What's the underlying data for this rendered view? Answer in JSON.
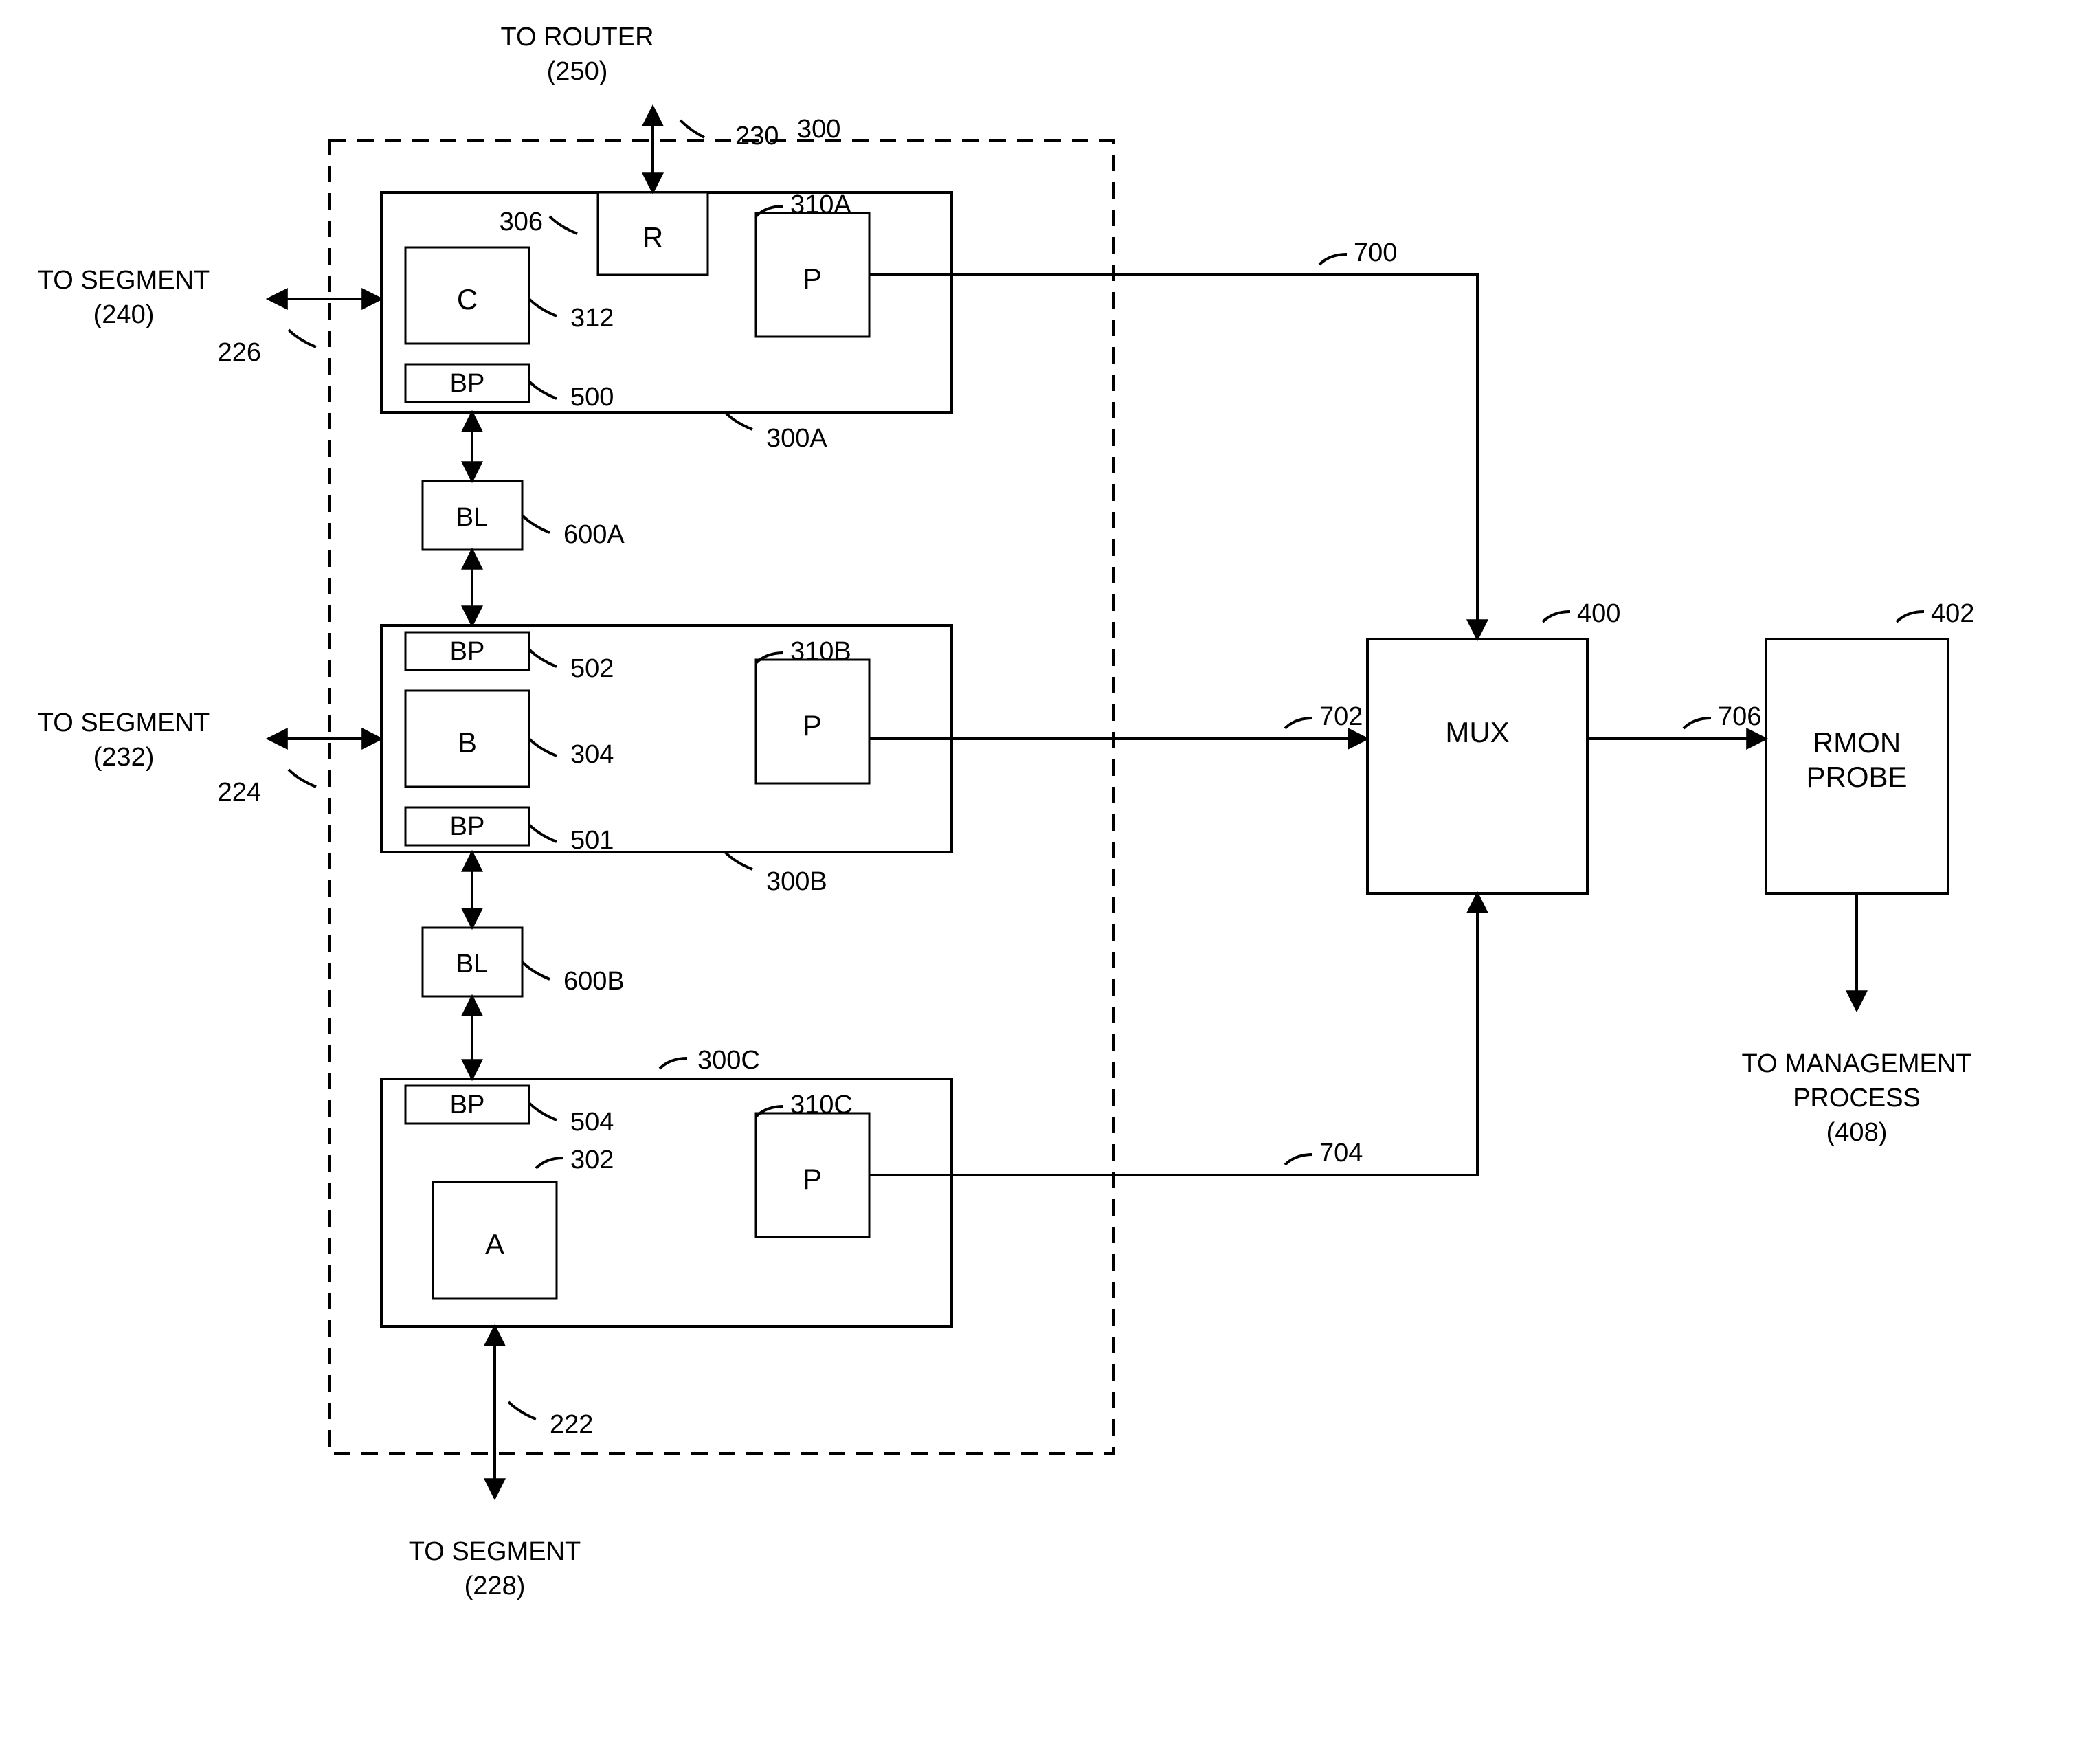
{
  "labels": {
    "to_router": "TO ROUTER",
    "to_router_ref": "(250)",
    "to_segment_240": "TO SEGMENT",
    "to_segment_240_ref": "(240)",
    "to_segment_232": "TO SEGMENT",
    "to_segment_232_ref": "(232)",
    "to_segment_228": "TO SEGMENT",
    "to_segment_228_ref": "(228)",
    "to_mgmt1": "TO MANAGEMENT",
    "to_mgmt2": "PROCESS",
    "to_mgmt_ref": "(408)"
  },
  "blocks": {
    "R": "R",
    "C": "C",
    "B": "B",
    "A": "A",
    "P": "P",
    "BP": "BP",
    "BL": "BL",
    "MUX": "MUX",
    "RMON1": "RMON",
    "RMON2": "PROBE"
  },
  "refs": {
    "r230": "230",
    "r300": "300",
    "r306": "306",
    "r310A": "310A",
    "r312": "312",
    "r500": "500",
    "r226": "226",
    "r300A": "300A",
    "r600A": "600A",
    "r502": "502",
    "r310B": "310B",
    "r304": "304",
    "r224": "224",
    "r501": "501",
    "r300B": "300B",
    "r600B": "600B",
    "r300C": "300C",
    "r504": "504",
    "r310C": "310C",
    "r302": "302",
    "r222": "222",
    "r400": "400",
    "r402": "402",
    "r700": "700",
    "r702": "702",
    "r704": "704",
    "r706": "706"
  }
}
